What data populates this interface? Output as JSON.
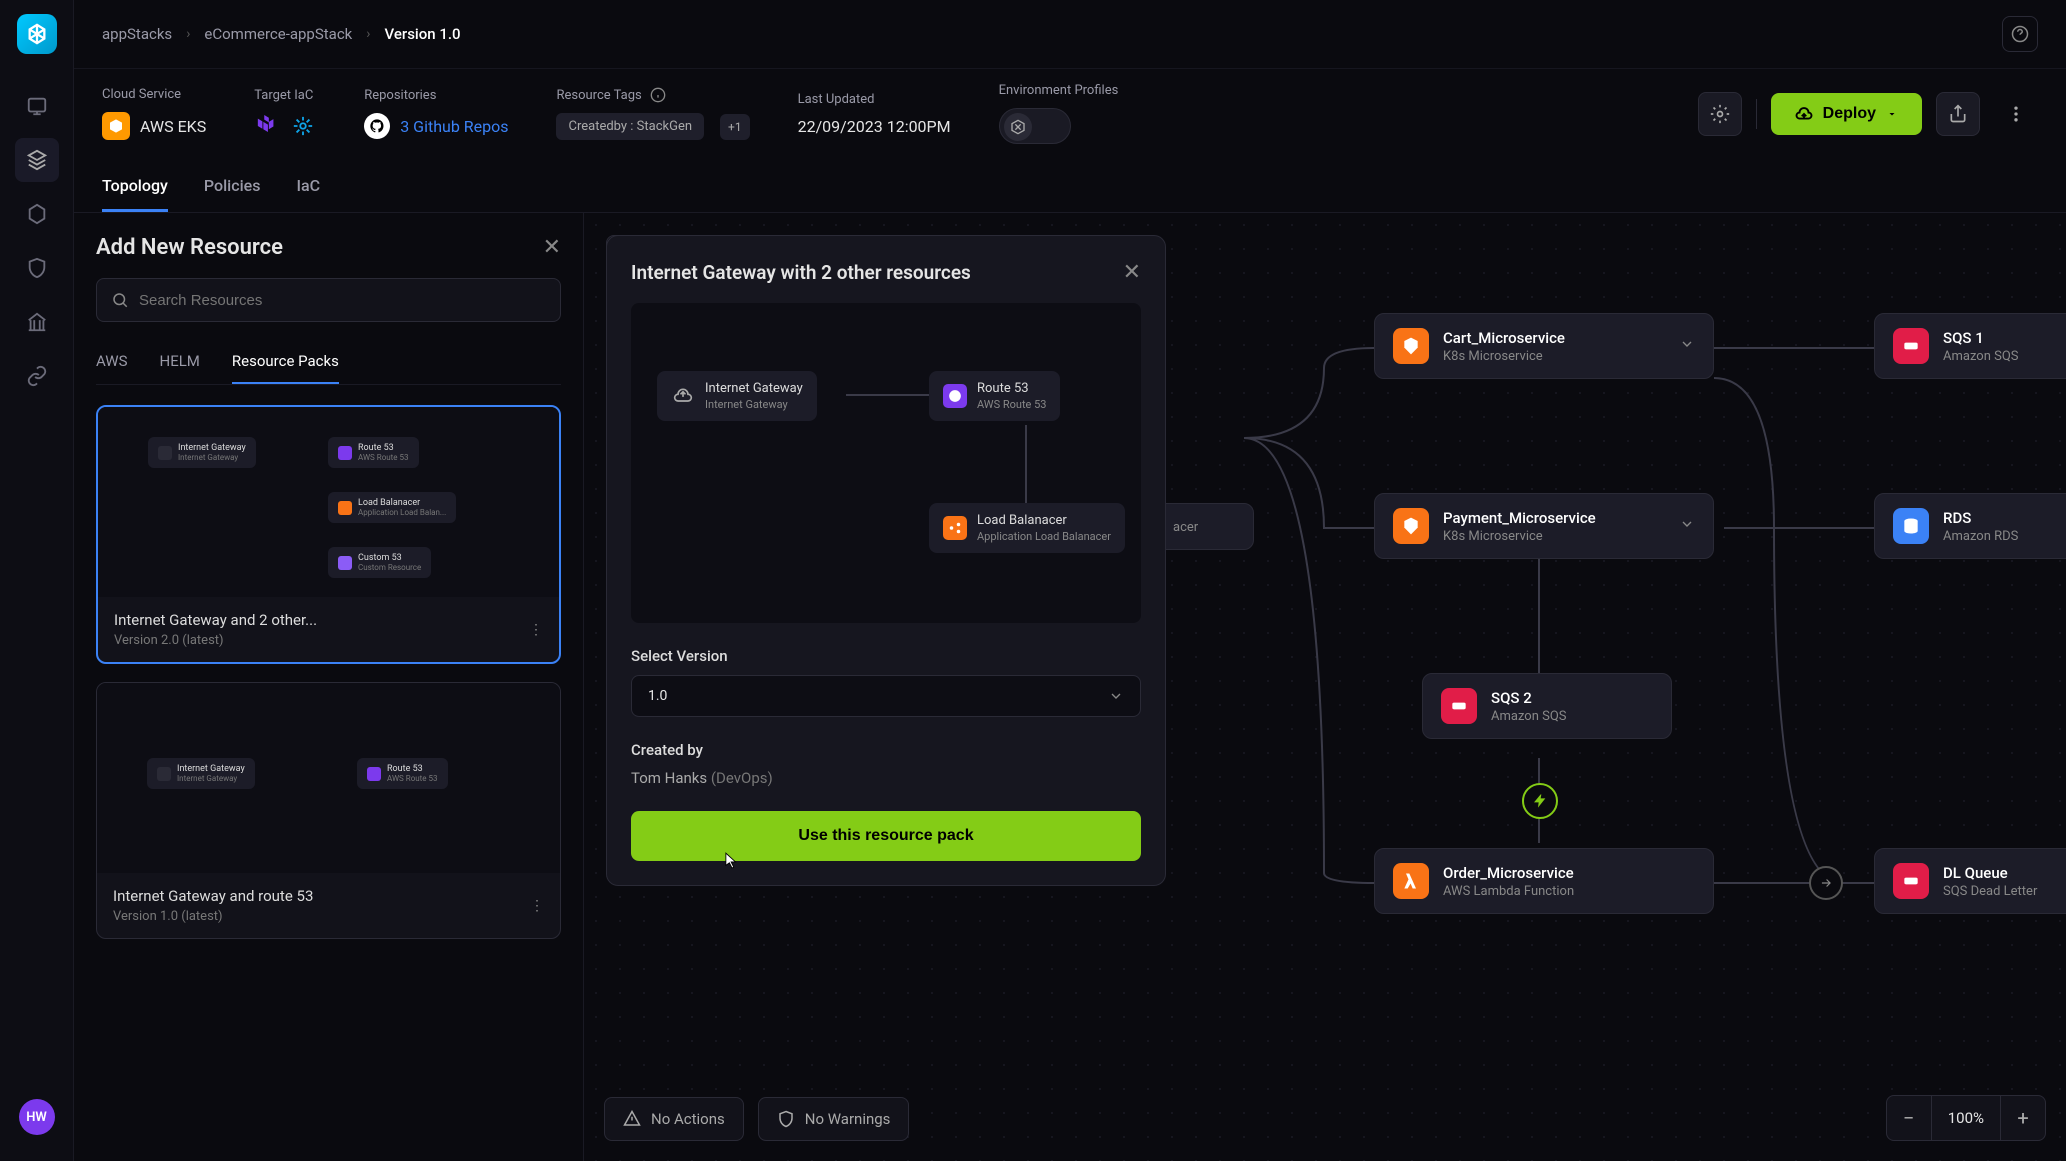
{
  "breadcrumbs": [
    "appStacks",
    "eCommerce-appStack",
    "Version 1.0"
  ],
  "avatar": "HW",
  "meta": {
    "cloud_label": "Cloud Service",
    "cloud_value": "AWS EKS",
    "iac_label": "Target IaC",
    "repos_label": "Repositories",
    "repos_value": "3 Github Repos",
    "tags_label": "Resource Tags",
    "tag_chip": "Createdby : StackGen",
    "tag_plus": "+1",
    "updated_label": "Last Updated",
    "updated_value": "22/09/2023 12:00PM",
    "env_label": "Environment Profiles",
    "deploy": "Deploy"
  },
  "tabs": [
    "Topology",
    "Policies",
    "IaC"
  ],
  "panel": {
    "title": "Add New Resource",
    "search_placeholder": "Search Resources",
    "subtabs": [
      "AWS",
      "HELM",
      "Resource Packs"
    ],
    "packs": [
      {
        "name": "Internet Gateway and 2 other...",
        "version": "Version 2.0 (latest)"
      },
      {
        "name": "Internet Gateway and route 53",
        "version": "Version 1.0 (latest)"
      }
    ]
  },
  "popup": {
    "title": "Internet Gateway with 2 other resources",
    "nodes": {
      "ig": {
        "t": "Internet Gateway",
        "s": "Internet Gateway"
      },
      "r53": {
        "t": "Route 53",
        "s": "AWS Route 53"
      },
      "lb": {
        "t": "Load Balanacer",
        "s": "Application Load Balanacer"
      }
    },
    "select_version_label": "Select Version",
    "version": "1.0",
    "created_by_label": "Created by",
    "created_by_name": "Tom Hanks",
    "created_by_role": "(DevOps)",
    "button": "Use this resource pack"
  },
  "canvas_nodes": {
    "partial": {
      "t": "",
      "s": "acer"
    },
    "cart": {
      "t": "Cart_Microservice",
      "s": "K8s Microservice"
    },
    "payment": {
      "t": "Payment_Microservice",
      "s": "K8s Microservice"
    },
    "sqs2": {
      "t": "SQS 2",
      "s": "Amazon SQS"
    },
    "order": {
      "t": "Order_Microservice",
      "s": "AWS Lambda Function"
    },
    "sqs1": {
      "t": "SQS 1",
      "s": "Amazon SQS"
    },
    "rds": {
      "t": "RDS",
      "s": "Amazon RDS"
    },
    "dl": {
      "t": "DL Queue",
      "s": "SQS Dead Letter"
    }
  },
  "bottom": {
    "actions": "No Actions",
    "warnings": "No Warnings"
  },
  "zoom": "100%"
}
